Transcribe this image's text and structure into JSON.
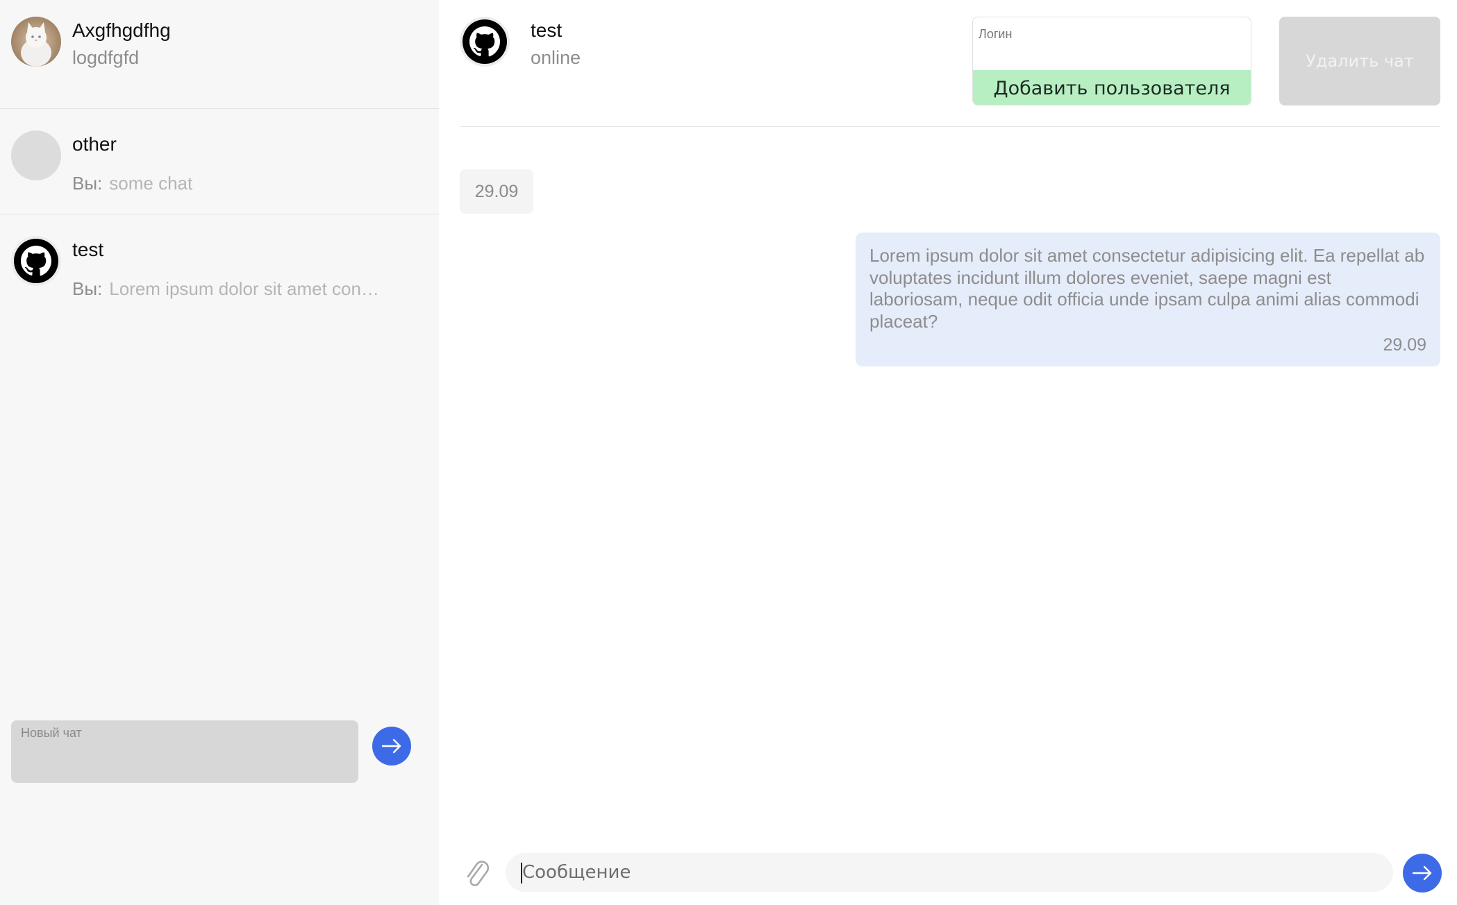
{
  "profile": {
    "name": "Axgfhgdfhg",
    "login": "logdfgfd"
  },
  "chats": [
    {
      "title": "other",
      "you_label": "Вы:",
      "preview": "some chat",
      "avatar": "placeholder"
    },
    {
      "title": "test",
      "you_label": "Вы:",
      "preview": "Lorem ipsum dolor sit amet con…",
      "avatar": "github-icon"
    }
  ],
  "new_chat": {
    "placeholder": "Новый чат"
  },
  "header": {
    "title": "test",
    "status": "online",
    "login_placeholder": "Логин",
    "add_user_label": "Добавить пользователя",
    "delete_chat_label": "Удалить чат"
  },
  "date_chip": "29.09",
  "messages": [
    {
      "text": "Lorem ipsum dolor sit amet consectetur adipisicing elit. Ea repellat ab voluptates incidunt illum dolores eveniet, saepe magni est laboriosam, neque odit officia unde ipsam culpa animi alias commodi placeat?",
      "time": "29.09"
    }
  ],
  "composer": {
    "placeholder": "Сообщение"
  },
  "colors": {
    "accent": "#3d6ae6",
    "add_user_bg": "#b7efc3",
    "message_bg": "#e5ecfa",
    "sidebar_bg": "#f7f7f7"
  }
}
